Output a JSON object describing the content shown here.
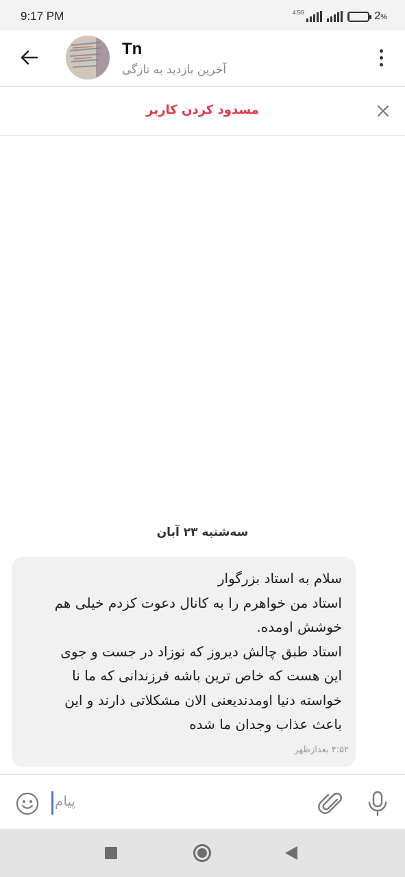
{
  "status_bar": {
    "time": "9:17 PM",
    "network_label": "4.5G",
    "battery_percent": "2",
    "battery_percent_sign": "%",
    "battery_level": 0.02
  },
  "header": {
    "contact_name": "Tn",
    "last_seen": "آخرین بازدید به تازگی"
  },
  "block_bar": {
    "label": "مسدود کردن کاربر"
  },
  "chat": {
    "date_label": "سه‌شنبه ۲۳ آبان",
    "messages": [
      {
        "text": "سلام به استاد بزرگوار\nاستاد من خواهرم را به کانال دعوت کزدم خیلی هم\nخوشش اومده.\nاستاد طبق چالش دیروز که نوزاد در جست و جوی\nاین هست که خاص ترین باشه فرزندانی که ما نا\nخواسته دنیا اومدندیعنی الان مشکلاتی دارند و این\nباعث عذاب وجدان ما شده",
        "time": "۴:۵۲ بعدازظهر"
      }
    ]
  },
  "composer": {
    "placeholder": "پیام"
  },
  "colors": {
    "accent_red": "#e0394a",
    "bubble_bg": "#f1f1f1",
    "caret": "#4a77c9"
  },
  "icons": {
    "back": "arrow-left-icon",
    "menu": "more-vertical-icon",
    "close": "close-icon",
    "emoji": "emoji-icon",
    "attach": "paperclip-icon",
    "mic": "microphone-icon"
  }
}
